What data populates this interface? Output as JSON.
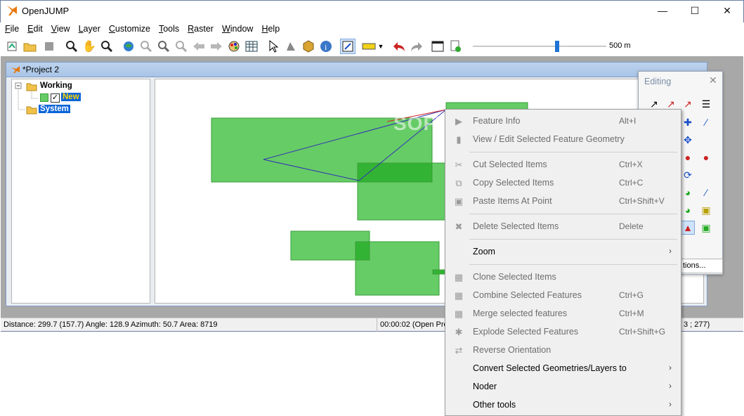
{
  "window": {
    "title": "OpenJUMP"
  },
  "menubar": {
    "items": [
      {
        "first": "F",
        "rest": "ile"
      },
      {
        "first": "E",
        "rest": "dit"
      },
      {
        "first": "V",
        "rest": "iew"
      },
      {
        "first": "L",
        "rest": "ayer"
      },
      {
        "first": "C",
        "rest": "ustomize"
      },
      {
        "first": "T",
        "rest": "ools"
      },
      {
        "first": "R",
        "rest": "aster"
      },
      {
        "first": "W",
        "rest": "indow"
      },
      {
        "first": "H",
        "rest": "elp"
      }
    ]
  },
  "toolbar": {
    "scale_label": "500 m",
    "zoom_level": 0.63
  },
  "project": {
    "title": "*Project 2"
  },
  "layers": {
    "working": "Working",
    "new_layer": "New",
    "system": "System"
  },
  "statusbar": {
    "measure": "Distance: 299.7 (157.7)  Angle: 128.9  Azimuth: 50.7  Area: 8719",
    "time": "00:00:02 (Open Pro",
    "coords": "3 ; 277)"
  },
  "palette": {
    "title": "Editing",
    "options": "tions..."
  },
  "watermark": "SOFTPEDIA",
  "context_menu": {
    "items": [
      {
        "label": "Feature Info",
        "shortcut": "Alt+I",
        "enabled": false,
        "icon": "feature-info-icon"
      },
      {
        "label": "View / Edit Selected Feature Geometry",
        "shortcut": "",
        "enabled": false,
        "icon": "view-edit-geometry-icon"
      },
      {
        "label": "Cut Selected Items",
        "shortcut": "Ctrl+X",
        "enabled": false,
        "icon": "cut-icon"
      },
      {
        "label": "Copy Selected Items",
        "shortcut": "Ctrl+C",
        "enabled": false,
        "icon": "copy-icon"
      },
      {
        "label": "Paste Items At Point",
        "shortcut": "Ctrl+Shift+V",
        "enabled": false,
        "icon": "paste-icon"
      },
      {
        "label": "Delete Selected Items",
        "shortcut": "Delete",
        "enabled": false,
        "icon": "delete-icon"
      },
      {
        "label": "Zoom",
        "shortcut": "",
        "enabled": true,
        "submenu": true
      },
      {
        "label": "Clone Selected Items",
        "shortcut": "",
        "enabled": false,
        "icon": "clone-icon"
      },
      {
        "label": "Combine Selected Features",
        "shortcut": "Ctrl+G",
        "enabled": false,
        "icon": "combine-icon"
      },
      {
        "label": "Merge selected features",
        "shortcut": "Ctrl+M",
        "enabled": false,
        "icon": "merge-icon"
      },
      {
        "label": "Explode Selected Features",
        "shortcut": "Ctrl+Shift+G",
        "enabled": false,
        "icon": "explode-icon"
      },
      {
        "label": "Reverse Orientation",
        "shortcut": "",
        "enabled": false,
        "icon": "reverse-icon"
      },
      {
        "label": "Convert Selected Geometries/Layers to",
        "shortcut": "",
        "enabled": true,
        "submenu": true
      },
      {
        "label": "Noder",
        "shortcut": "",
        "enabled": true,
        "submenu": true
      },
      {
        "label": "Other tools",
        "shortcut": "",
        "enabled": true,
        "submenu": true
      }
    ]
  },
  "colors": {
    "feature_fill": "#66cc66",
    "feature_stroke": "#3a9e3a",
    "selection": "#0a64d8",
    "measure_line": "#3232b4"
  }
}
